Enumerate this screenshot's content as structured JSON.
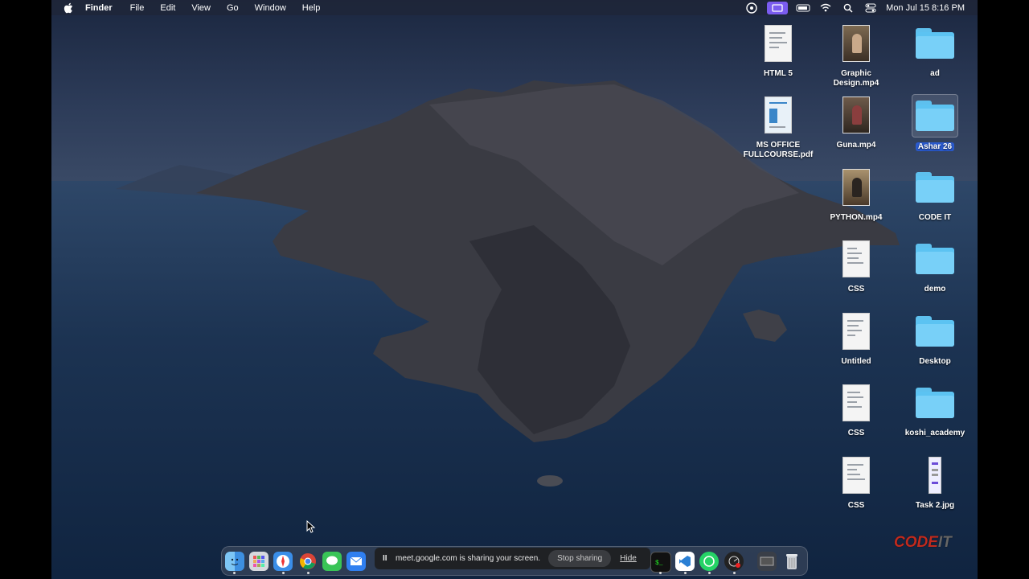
{
  "menubar": {
    "apple_icon": "apple-logo-icon",
    "app_name": "Finder",
    "items": [
      "File",
      "Edit",
      "View",
      "Go",
      "Window",
      "Help"
    ],
    "status_icons": [
      "creative-cloud-icon",
      "screen-share-icon",
      "battery-icon",
      "wifi-icon",
      "search-icon",
      "control-center-icon"
    ],
    "clock": "Mon Jul 15  8:16 PM"
  },
  "desktop": {
    "icons": [
      {
        "label": "HTML 5",
        "kind": "document"
      },
      {
        "label": "Graphic Design.mp4",
        "kind": "video"
      },
      {
        "label": "ad",
        "kind": "folder"
      },
      {
        "label": "MS OFFICE FULLCOURSE.pdf",
        "kind": "pdf"
      },
      {
        "label": "Guna.mp4",
        "kind": "video"
      },
      {
        "label": "Ashar 26",
        "kind": "folder",
        "selected": true
      },
      {
        "label": "PYTHON.mp4",
        "kind": "video"
      },
      {
        "label": "CODE IT",
        "kind": "folder"
      },
      {
        "label": "CSS",
        "kind": "document"
      },
      {
        "label": "demo",
        "kind": "folder"
      },
      {
        "label": "Untitled",
        "kind": "document"
      },
      {
        "label": "Desktop",
        "kind": "folder"
      },
      {
        "label": "CSS",
        "kind": "document"
      },
      {
        "label": "koshi_academy",
        "kind": "folder"
      },
      {
        "label": "CSS",
        "kind": "document"
      },
      {
        "label": "Task 2.jpg",
        "kind": "image"
      }
    ]
  },
  "dock": {
    "apps": [
      "finder-icon",
      "launchpad-icon",
      "safari-icon",
      "chrome-icon",
      "messages-icon",
      "mail-icon",
      "terminal-icon",
      "vscode-icon",
      "whatsapp-icon",
      "activity-icon",
      "screenshot-icon",
      "trash-icon"
    ]
  },
  "share_bar": {
    "pause_glyph": "II",
    "message": "meet.google.com is sharing your screen.",
    "stop_label": "Stop sharing",
    "hide_label": "Hide"
  },
  "watermark": {
    "text_a": "CODE",
    "text_b": "IT"
  }
}
